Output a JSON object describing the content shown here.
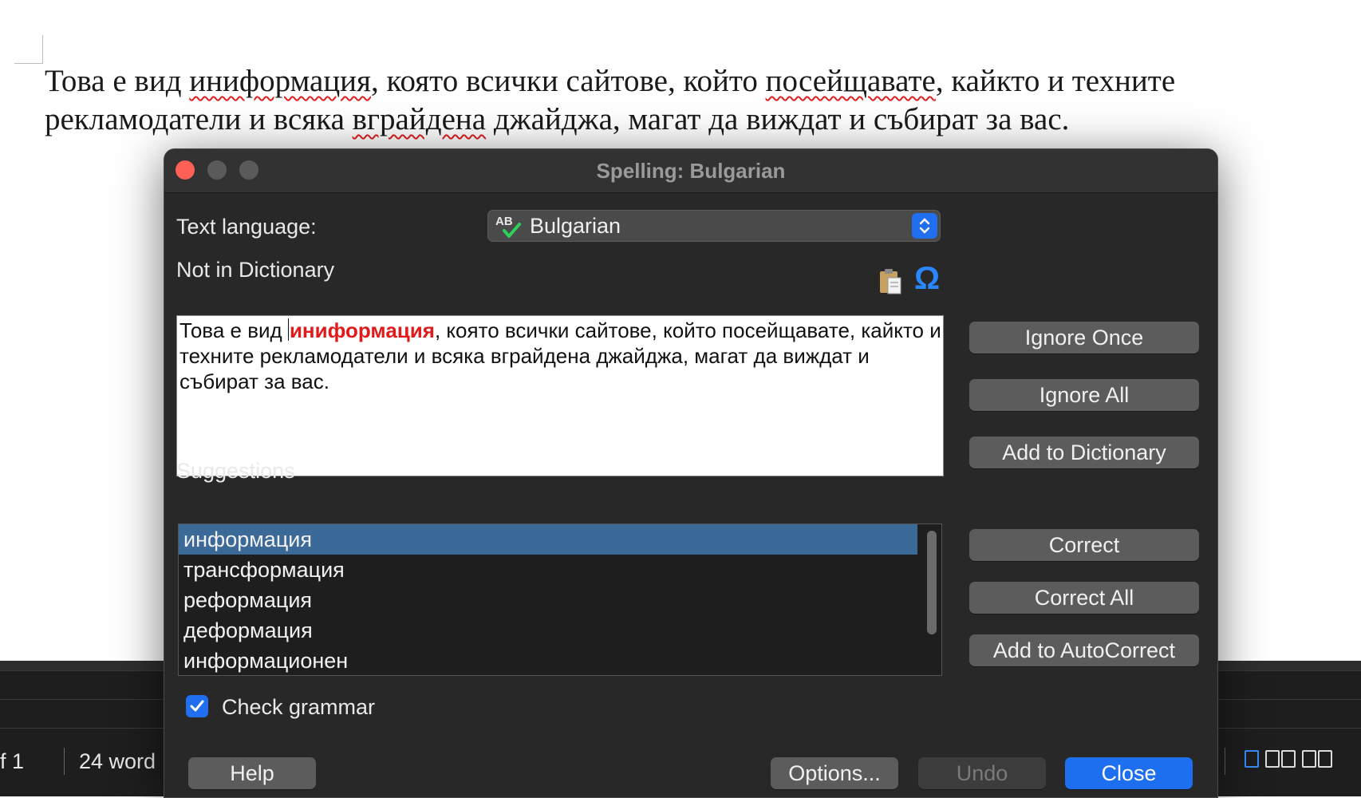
{
  "document": {
    "line1": {
      "w1": "Това е вид ",
      "w2": "иниформация",
      "w3": ", която всички сайтове, който ",
      "w4": "посейщавате",
      "w5": ", кайкто и техните"
    },
    "line2": {
      "w1": "рекламодатели и всяка ",
      "w2": "вграйдена",
      "w3": " джайджа, магат да виждат и събират за вас."
    }
  },
  "status_bar": {
    "page": "f 1",
    "words": "24 word"
  },
  "dialog": {
    "title": "Spelling: Bulgarian",
    "text_language_label": "Text language:",
    "language_value": "Bulgarian",
    "language_icon_text": "AB",
    "not_in_dictionary_label": "Not in Dictionary",
    "context": {
      "before": "Това е вид ",
      "error": "иниформация",
      "after": ", която всички сайтове, който посейщавате, кайкто и техните рекламодатели и всяка вграйдена джайджа, магат да виждат и събират за вас."
    },
    "suggestions_label": "Suggestions",
    "suggestions": [
      "информация",
      "трансформация",
      "реформация",
      "деформация",
      "информационен"
    ],
    "buttons": {
      "ignore_once": "Ignore Once",
      "ignore_all": "Ignore All",
      "add_to_dictionary": "Add to Dictionary",
      "correct": "Correct",
      "correct_all": "Correct All",
      "add_to_autocorrect": "Add to AutoCorrect",
      "help": "Help",
      "options": "Options...",
      "undo": "Undo",
      "close": "Close"
    },
    "check_grammar_label": "Check grammar",
    "icons": {
      "special_char": "Ω"
    }
  },
  "colors": {
    "accent": "#1d6ff0",
    "error_text": "#e11b1b",
    "selection": "#3c6a98",
    "dialog_bg": "#282828"
  }
}
